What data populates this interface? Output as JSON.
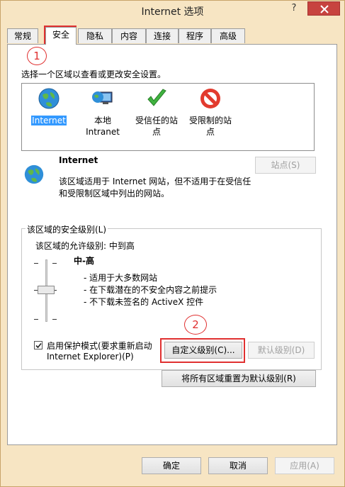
{
  "window": {
    "title": "Internet 选项",
    "help": "?"
  },
  "tabs": [
    {
      "label": "常规"
    },
    {
      "label": "安全"
    },
    {
      "label": "隐私"
    },
    {
      "label": "内容"
    },
    {
      "label": "连接"
    },
    {
      "label": "程序"
    },
    {
      "label": "高级"
    }
  ],
  "annotations": {
    "one": "1",
    "two": "2"
  },
  "security": {
    "instruction": "选择一个区域以查看或更改安全设置。",
    "zones": [
      {
        "label": "Internet"
      },
      {
        "label": "本地\nIntranet"
      },
      {
        "label": "受信任的站\n点"
      },
      {
        "label": "受限制的站\n点"
      }
    ],
    "zone_title": "Internet",
    "zone_desc": "该区域适用于 Internet 网站，但不适用于在受信任和受限制区域中列出的网站。",
    "sites_button": "站点(S)",
    "group_label": "该区域的安全级别(L)",
    "allowed_levels": "该区域的允许级别: 中到高",
    "level_name": "中-高",
    "level_details": [
      "- 适用于大多数网站",
      "- 在下载潜在的不安全内容之前提示",
      "- 不下载未签名的 ActiveX 控件"
    ],
    "protected_mode_line1": "启用保护模式(要求重新启动",
    "protected_mode_line2": "Internet Explorer)(P)",
    "protected_mode_checked": true,
    "custom_level_button": "自定义级别(C)...",
    "default_level_button": "默认级别(D)",
    "reset_all_button": "将所有区域重置为默认级别(R)"
  },
  "footer": {
    "ok": "确定",
    "cancel": "取消",
    "apply": "应用(A)"
  },
  "colors": {
    "highlight": "#e03030",
    "selection": "#3399ff",
    "close": "#c7433f"
  }
}
